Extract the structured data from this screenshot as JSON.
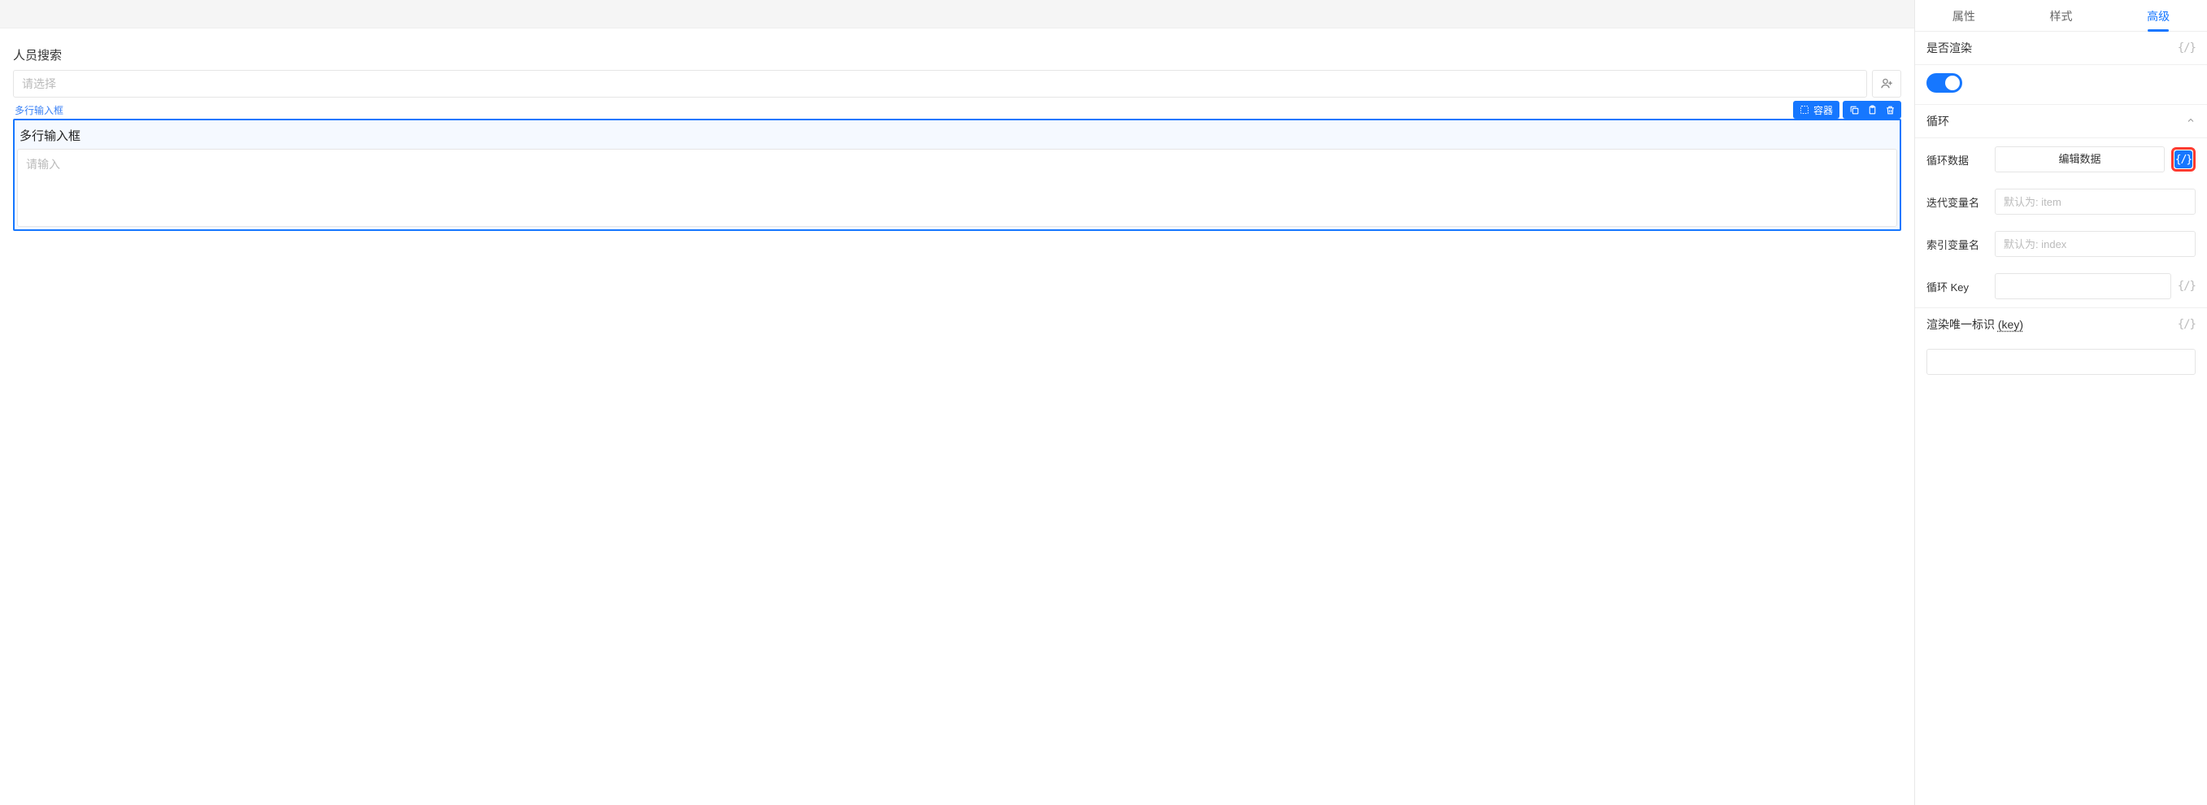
{
  "canvas": {
    "employee_search": {
      "label": "人员搜索",
      "placeholder": "请选择"
    },
    "selected": {
      "tag_label": "多行输入框",
      "container_pill": "容器",
      "inner_label": "多行输入框",
      "textarea_placeholder": "请输入"
    }
  },
  "panel": {
    "tabs": {
      "attr": "属性",
      "style": "样式",
      "advanced": "高级"
    },
    "render": {
      "label": "是否渲染",
      "braces": "{/}"
    },
    "loop": {
      "title": "循环",
      "data_label": "循环数据",
      "edit_button": "编辑数据",
      "braces": "{/}",
      "iter_label": "迭代变量名",
      "iter_placeholder": "默认为: item",
      "index_label": "索引变量名",
      "index_placeholder": "默认为: index",
      "key_label": "循环 Key",
      "key_braces": "{/}"
    },
    "render_id": {
      "label_prefix": "渲染唯一标识 ",
      "label_key": "(key)",
      "braces": "{/}"
    }
  }
}
